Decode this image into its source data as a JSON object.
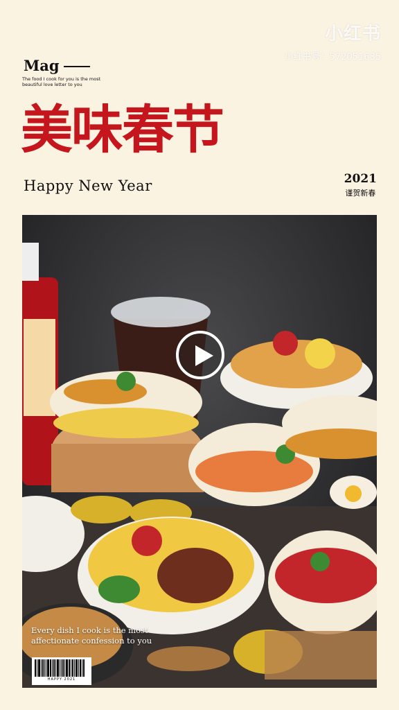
{
  "watermark": {
    "app_name": "小红书",
    "user_id": "小红书号：572051635"
  },
  "header": {
    "mag_label": "Mag",
    "mag_tagline": "The food I cook for you is the most beautiful love letter to you",
    "title": "美味春节",
    "subtitle": "Happy New Year",
    "year": "2021",
    "year_subtitle": "谨贺新春"
  },
  "photo": {
    "caption": "Every dish I cook is the most affectionate confession to you",
    "barcode_text": "HAPPY 2021"
  },
  "colors": {
    "background": "#fbf3e2",
    "title_red": "#c4161c"
  },
  "icons": {
    "play": "play-icon"
  }
}
